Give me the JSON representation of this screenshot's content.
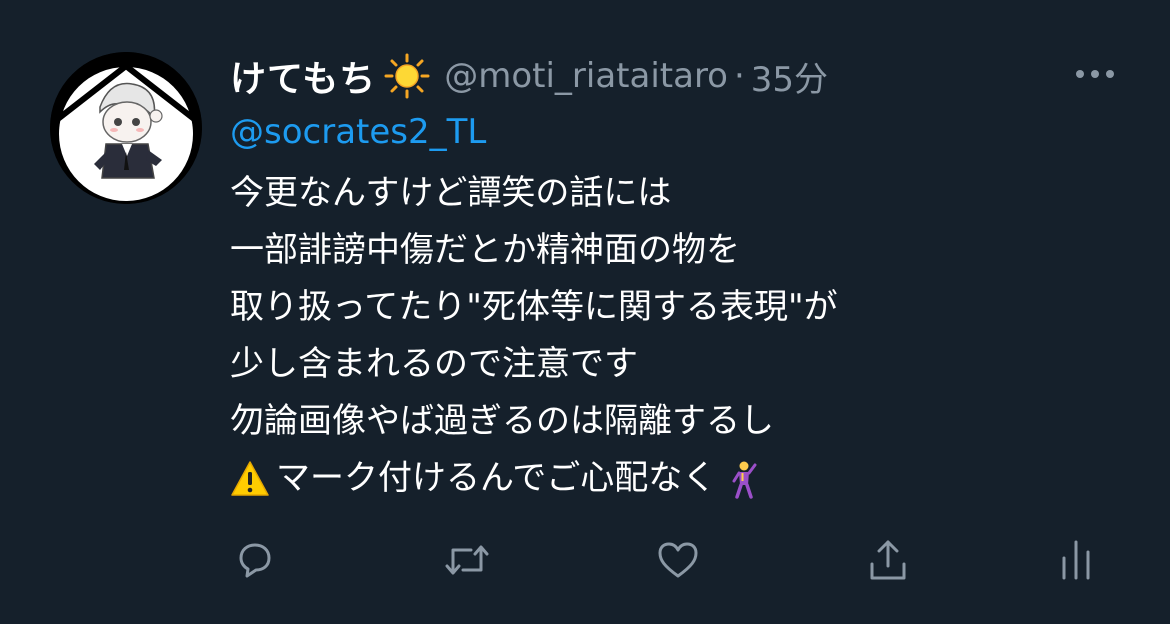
{
  "tweet": {
    "display_name": "けてもち",
    "name_emoji": "sun-icon",
    "handle": "@moti_riataitaro",
    "separator": "·",
    "time": "35分",
    "reply_to": "@socrates2_TL",
    "lines": [
      "今更なんすけど譚笑の話には",
      "一部誹謗中傷だとか精神面の物を",
      "取り扱ってたり\"死体等に関する表現\"が",
      "少し含まれるので注意です",
      "勿論画像やば過ぎるのは隔離するし",
      "マーク付けるんでご心配なく"
    ],
    "line6_leading_icon": "warning-icon",
    "line6_trailing_icon": "dancer-icon"
  },
  "actions": {
    "reply": "reply-icon",
    "retweet": "retweet-icon",
    "like": "heart-icon",
    "share": "share-icon",
    "analytics": "analytics-icon"
  },
  "colors": {
    "background": "#15202b",
    "text": "#ffffff",
    "secondary": "#8b98a5",
    "link": "#1d9bf0"
  }
}
